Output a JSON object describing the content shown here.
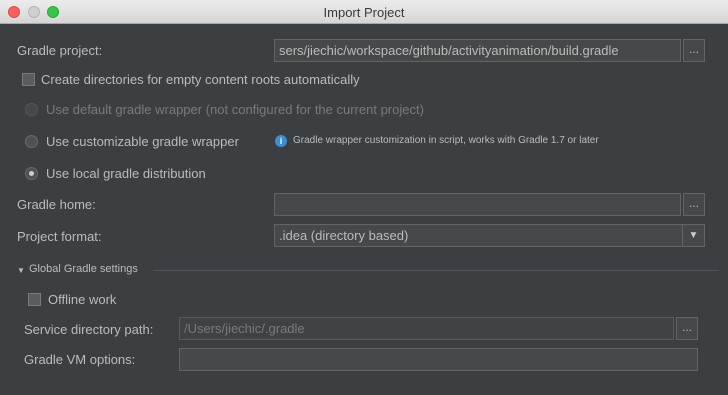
{
  "window": {
    "title": "Import Project"
  },
  "gradle_project": {
    "label": "Gradle project:",
    "value": "sers/jiechic/workspace/github/activityanimation/build.gradle",
    "browse": "..."
  },
  "create_dirs": {
    "label": "Create directories for empty content roots automatically",
    "checked": false
  },
  "wrapper_options": {
    "default_wrapper": {
      "label": "Use default gradle wrapper (not configured for the current project)",
      "enabled": false
    },
    "custom_wrapper": {
      "label": "Use customizable gradle wrapper"
    },
    "custom_hint": "Gradle wrapper customization in script, works with Gradle 1.7 or later",
    "local_dist": {
      "label": "Use local gradle distribution",
      "selected": true
    }
  },
  "gradle_home": {
    "label": "Gradle home:",
    "value": "",
    "browse": "..."
  },
  "project_format": {
    "label": "Project format:",
    "value": ".idea (directory based)"
  },
  "global_settings": {
    "header": "Global Gradle settings",
    "offline_work": {
      "label": "Offline work",
      "checked": false
    },
    "service_dir": {
      "label": "Service directory path:",
      "value": "/Users/jiechic/.gradle",
      "browse": "..."
    },
    "vm_options": {
      "label": "Gradle VM options:",
      "value": ""
    }
  },
  "icons": {
    "info": "info-icon",
    "dropdown": "chevron-down-icon",
    "collapse": "triangle-down-icon"
  }
}
